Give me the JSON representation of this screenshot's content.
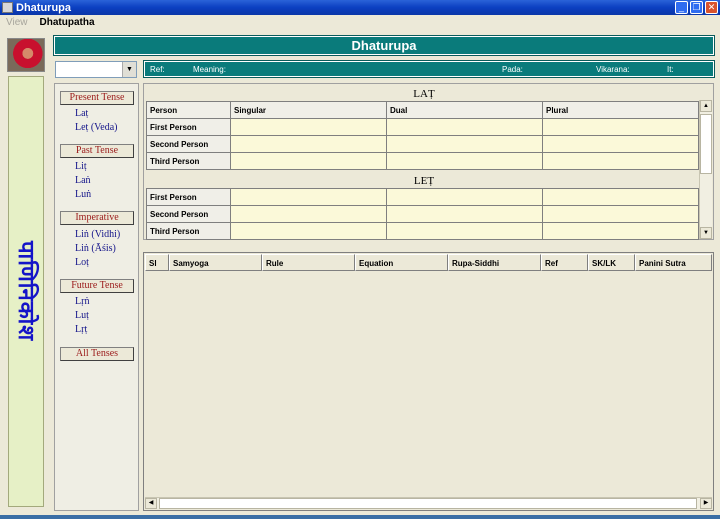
{
  "window": {
    "title": "Dhaturupa"
  },
  "menu": {
    "view": "View",
    "dhatupatha": "Dhatupatha"
  },
  "header": {
    "title": "Dhaturupa"
  },
  "banner": {
    "text": "पाणिनिकोश"
  },
  "combo": {
    "value": ""
  },
  "info_bar": {
    "ref": "Ref:",
    "meaning": "Meaning:",
    "pada": "Pada:",
    "vikarana": "Vikarana:",
    "it": "It:"
  },
  "tenses": {
    "present": {
      "label": "Present Tense",
      "items": [
        "Laṭ",
        "Leṭ (Veda)"
      ]
    },
    "past": {
      "label": "Past Tense",
      "items": [
        "Liṭ",
        "Laṅ",
        "Luṅ"
      ]
    },
    "imperative": {
      "label": "Imperative",
      "items": [
        "Liṅ (Vidhi)",
        "Liṅ (Āśis)",
        "Loṭ"
      ]
    },
    "future": {
      "label": "Future Tense",
      "items": [
        "Lṛṅ",
        "Luṭ",
        "Lṛṭ"
      ]
    },
    "all": {
      "label": "All Tenses"
    }
  },
  "lat_table": {
    "title": "LAṬ",
    "headers": [
      "Person",
      "Singular",
      "Dual",
      "Plural"
    ],
    "rows": [
      "First Person",
      "Second Person",
      "Third Person"
    ]
  },
  "let_table": {
    "title": "LEṬ",
    "rows": [
      "First Person",
      "Second Person",
      "Third Person"
    ]
  },
  "bottom_table": {
    "headers": [
      "Sl",
      "Samyoga",
      "Rule",
      "Equation",
      "Rupa-Siddhi",
      "Ref",
      "SK/LK",
      "Panini Sutra"
    ]
  }
}
